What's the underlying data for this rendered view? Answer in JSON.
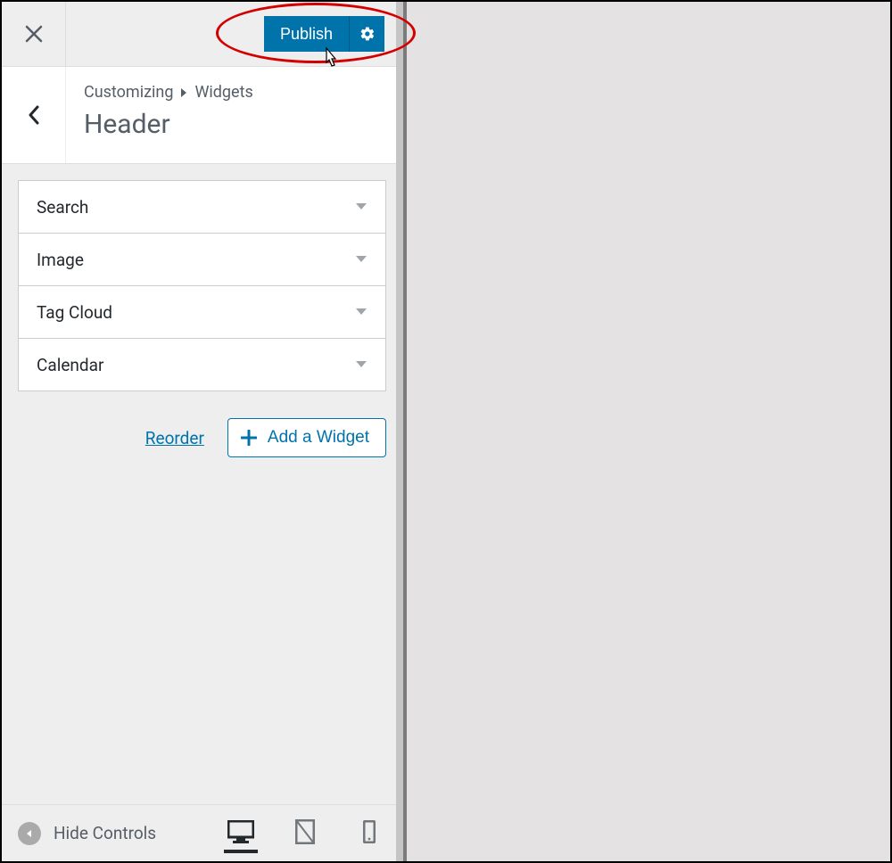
{
  "top": {
    "publish_label": "Publish"
  },
  "breadcrumb": {
    "root": "Customizing",
    "section": "Widgets"
  },
  "title": "Header",
  "widgets": [
    {
      "label": "Search"
    },
    {
      "label": "Image"
    },
    {
      "label": "Tag Cloud"
    },
    {
      "label": "Calendar"
    }
  ],
  "actions": {
    "reorder": "Reorder",
    "add_widget": "Add a Widget"
  },
  "footer": {
    "hide_controls": "Hide Controls"
  }
}
